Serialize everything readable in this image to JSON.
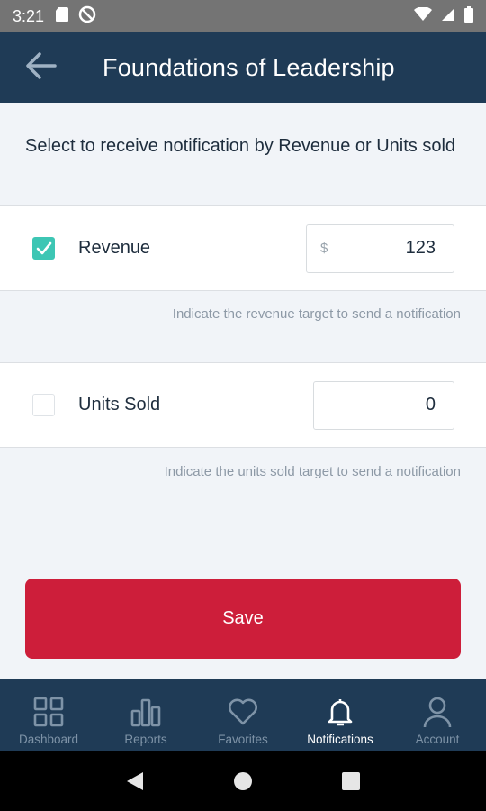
{
  "status_bar": {
    "time": "3:21",
    "left_icons": [
      "sd-card-icon",
      "no-sync-icon"
    ],
    "right_icons": [
      "wifi-icon",
      "cell-signal-icon",
      "battery-icon"
    ]
  },
  "app_bar": {
    "title": "Foundations of Leadership",
    "back_icon": "arrow-left-icon"
  },
  "intro_text": "Select to receive notification by Revenue or Units sold",
  "revenue": {
    "label": "Revenue",
    "checked": true,
    "currency_symbol": "$",
    "value": "123",
    "hint": "Indicate the revenue target to send a notification"
  },
  "units": {
    "label": "Units Sold",
    "checked": false,
    "value": "0",
    "hint": "Indicate the units sold target to send a notification"
  },
  "save_label": "Save",
  "bottom_nav": {
    "items": [
      {
        "label": "Dashboard",
        "icon": "grid-icon",
        "active": false
      },
      {
        "label": "Reports",
        "icon": "bar-chart-icon",
        "active": false
      },
      {
        "label": "Favorites",
        "icon": "heart-icon",
        "active": false
      },
      {
        "label": "Notifications",
        "icon": "bell-icon",
        "active": true
      },
      {
        "label": "Account",
        "icon": "user-icon",
        "active": false
      }
    ]
  },
  "system_nav": [
    "back-triangle-icon",
    "home-circle-icon",
    "recents-square-icon"
  ],
  "colors": {
    "app_bar": "#1f3b56",
    "accent_check": "#3dc6b4",
    "save_button": "#cd1e3a",
    "background": "#f1f4f8"
  }
}
